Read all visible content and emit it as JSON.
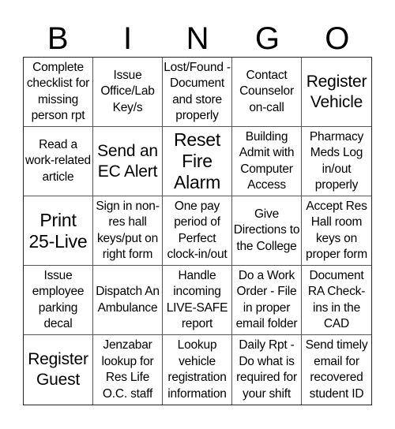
{
  "header": {
    "letters": [
      "B",
      "I",
      "N",
      "G",
      "O"
    ]
  },
  "cells": [
    {
      "text": "Complete checklist for missing person rpt",
      "size": "normal"
    },
    {
      "text": "Issue Office/Lab Key/s",
      "size": "normal"
    },
    {
      "text": "Lost/Found -Document and store properly",
      "size": "normal"
    },
    {
      "text": "Contact Counselor on-call",
      "size": "normal"
    },
    {
      "text": "Register Vehicle",
      "size": "big"
    },
    {
      "text": "Read a work-related article",
      "size": "normal"
    },
    {
      "text": "Send an EC Alert",
      "size": "big"
    },
    {
      "text": "Reset Fire Alarm",
      "size": "huge"
    },
    {
      "text": "Building Admit with Computer Access",
      "size": "normal"
    },
    {
      "text": "Pharmacy Meds Log in/out properly",
      "size": "normal"
    },
    {
      "text": "Print 25-Live",
      "size": "huge"
    },
    {
      "text": "Sign in non-res hall keys/put on right form",
      "size": "normal"
    },
    {
      "text": "One pay period of Perfect clock-in/out",
      "size": "normal"
    },
    {
      "text": "Give Directions to the College",
      "size": "normal"
    },
    {
      "text": "Accept Res Hall room keys on proper form",
      "size": "normal"
    },
    {
      "text": "Issue employee parking decal",
      "size": "normal"
    },
    {
      "text": "Dispatch An Ambulance",
      "size": "normal"
    },
    {
      "text": "Handle incoming LIVE-SAFE report",
      "size": "normal"
    },
    {
      "text": "Do a Work Order - File in proper email folder",
      "size": "normal"
    },
    {
      "text": "Document RA Check-ins in the CAD",
      "size": "normal"
    },
    {
      "text": "Register Guest",
      "size": "big"
    },
    {
      "text": "Jenzabar lookup for Res Life O.C. staff",
      "size": "normal"
    },
    {
      "text": "Lookup vehicle registration information",
      "size": "normal"
    },
    {
      "text": "Daily Rpt - Do what is required for your shift",
      "size": "normal"
    },
    {
      "text": "Send timely email for recovered student ID",
      "size": "normal"
    }
  ]
}
